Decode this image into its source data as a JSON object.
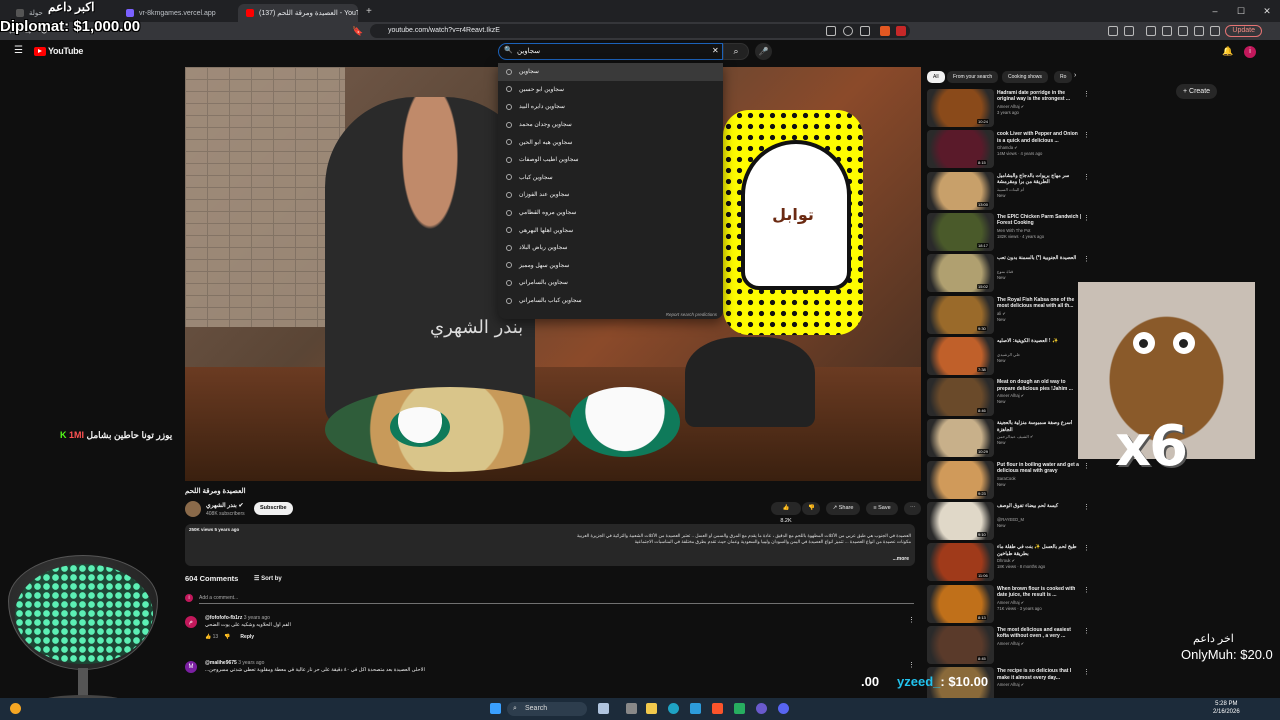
{
  "browser": {
    "tabs": [
      {
        "label": "حولة",
        "fav": "#555"
      },
      {
        "label": "vr-8kmgames.vercel.app",
        "fav": "#7b61ff"
      },
      {
        "label": "(137) العصيدة ومرقة اللحم - YouTube",
        "fav": "#ff0000"
      }
    ],
    "new_tab": "+",
    "url": "youtube.com/watch?v=r4Reavt.IkzE",
    "update_label": "Update"
  },
  "youtube": {
    "logo": "YouTube",
    "search_value": "سجاوين",
    "create_label": "+ Create",
    "suggestions": [
      "سجاوين",
      "سجاوين ابو حسين",
      "سجاوين دايره البيد",
      "سجاوين وجدان محمد",
      "سجاوين هيه ابو الحين",
      "سجاوين اطيب الوصفات",
      "سجاوين كباب",
      "سجاوين عند الفوزان",
      "سجاوين مروه القطامي",
      "سجاوين اهلها البهرهي",
      "سجاوين رياض البلاد",
      "سجاوين سهل ومميز",
      "سجاوين بالسامراني",
      "سجاوين كباب بالسامراني"
    ],
    "report_predictions": "Report search predictions",
    "video": {
      "title": "العصيدة ومرقة اللحم",
      "channel": "بندر الشهري ✔",
      "subscribers": "408K subscribers",
      "subscribe_label": "Subscribe",
      "likes": "8.2K",
      "share_label": "Share",
      "save_label": "Save",
      "snap_brand": "توابل",
      "apron_text": "بندر الشهري"
    },
    "description": {
      "meta": "250K views  5 years ago",
      "line1": "العصيدة في الجنوب هي طبق عربي من الأكلات المطهوة باللحم مع الدقيق ، عادة ما يقدم مع المرق والسمن أو العسل .. تعتبر العصيدة من الأكلات الشعبية والتراثية في الجزيرة العربية",
      "line2": "مكونات عصيدة من انواع العصيدة ... تتميز أنواع العصيدة في اليمن والسودان وليبيا والسعودية وعمان حيث تقدم بطرق مختلفة في المناسبات الاجتماعية",
      "more": "...more"
    },
    "comments": {
      "count": "604 Comments",
      "sort_label": "Sort by",
      "add_placeholder": "Add a comment...",
      "items": [
        {
          "avatar": "م",
          "user": "@fofofofo-fb1rz",
          "time": "3 years ago",
          "text": "الفم اول الحلاويه وشكيه على يوت الضحي",
          "likes": "13",
          "reply": "Reply",
          "color": "#c2185b"
        },
        {
          "avatar": "M",
          "user": "@malihe9675",
          "time": "3 years ago",
          "text": "الاحلى العصيدة بعد متصحدة اكل في ٤٠ دقيقة على حر نار عالية في معطة ومقلوبة تعطي شدتي مسروجن...",
          "likes": "",
          "reply": "",
          "color": "#7b1fa2"
        }
      ]
    },
    "chips": [
      "All",
      "From your search",
      "Cooking shows",
      "Ro"
    ],
    "recommendations": [
      {
        "title": "Hadrami date porridge in the original way is the strongest ...",
        "channel": "Ameer Alhaj ✔",
        "views": "3 years ago",
        "dur": "10:24",
        "color": "#8a4a1a"
      },
      {
        "title": "cook Liver with Pepper and Onion is a quick and delicious ...",
        "channel": "Ghamda ✔",
        "views": "14M views · 4 years ago",
        "dur": "8:15",
        "color": "#5a1a2a"
      },
      {
        "title": "سر مهاج بريوات بالدجاج والبشاميل الطريقة من برا ومقرمشة",
        "channel": "أم البنات السيبة",
        "views": "New",
        "dur": "13:00",
        "color": "#c8a06a"
      },
      {
        "title": "The EPIC Chicken Parm Sandwich | Forest Cooking",
        "channel": "Men With The Pot",
        "views": "182K views · 4 years ago",
        "dur": "18:17",
        "color": "#4a5a2a"
      },
      {
        "title": "العصيدة الجنوبية (*) بالسمنة بدون تعب",
        "channel": "قناة منوع",
        "views": "New",
        "dur": "15:02",
        "color": "#b0a070"
      },
      {
        "title": "The Royal Fish Kabsa one of the most delicious meal with all th...",
        "channel": "ali ✔",
        "views": "New",
        "dur": "9:30",
        "color": "#9a6a2a"
      },
      {
        "title": "العصيدة الكويتية: الاصليه ! ✨",
        "channel": "علي الرشيدي",
        "views": "New",
        "dur": "7:38",
        "color": "#c0602a"
      },
      {
        "title": "Meat on dough an old way to prepare delicious pies !Jahim ...",
        "channel": "Ameer Alhaj ✔",
        "views": "New",
        "dur": "8:46",
        "color": "#6a4a2a"
      },
      {
        "title": "أسرع وصفة سمبوسة منزلية بالعجينة الجاهزة",
        "channel": "الشيف عبدالرحمن ✔",
        "views": "New",
        "dur": "10:29",
        "color": "#c8b08a"
      },
      {
        "title": "Put flour in boiling water and get a delicious meal with gravy",
        "channel": "SaraCook",
        "views": "New",
        "dur": "9:23",
        "color": "#d09a5a"
      },
      {
        "title": "كبسة لحم بيضاء تفوق الوصف",
        "channel": "@RAYEED_M",
        "views": "New",
        "dur": "9:10",
        "color": "#e0d8c8"
      },
      {
        "title": "طبخ لحم بالعسل ✨ بنت في طفلة ماء بطريقة طباخين",
        "channel": "Dhrouk ✔",
        "views": "18K views · 8 months ago",
        "dur": "11:06",
        "color": "#a03a1a"
      },
      {
        "title": "When brown flour is cooked with date juice, the result is ...",
        "channel": "Ameer Alhaj ✔",
        "views": "71K views · 3 years ago",
        "dur": "8:13",
        "color": "#c0701a"
      },
      {
        "title": "The most delicious and easiest kofta without oven , a very ...",
        "channel": "Ameer Alhaj ✔",
        "views": "",
        "dur": "8:45",
        "color": "#5a3a2a"
      },
      {
        "title": "The recipe is so delicious that I make it almost every day...",
        "channel": "Ameer Alhaj ✔",
        "views": "",
        "dur": "",
        "color": "#8a6a3a"
      }
    ]
  },
  "stream": {
    "diplomat": "Diplomat: $1,000.00",
    "top_name": "اكبر داعم",
    "kick_line": "يوزر تونا حاطين بشامل",
    "kick_count": "1MI",
    "x6": "x6",
    "onlymuh_name": "اخر داعم",
    "onlymuh": "OnlyMuh: $20.0",
    "yzeed_prefix": "yzeed_",
    "yzeed_amount": ": $10.00",
    "zero": ".00"
  },
  "taskbar": {
    "search": "Search",
    "time": "5:28 PM",
    "date": "2/16/2026"
  }
}
